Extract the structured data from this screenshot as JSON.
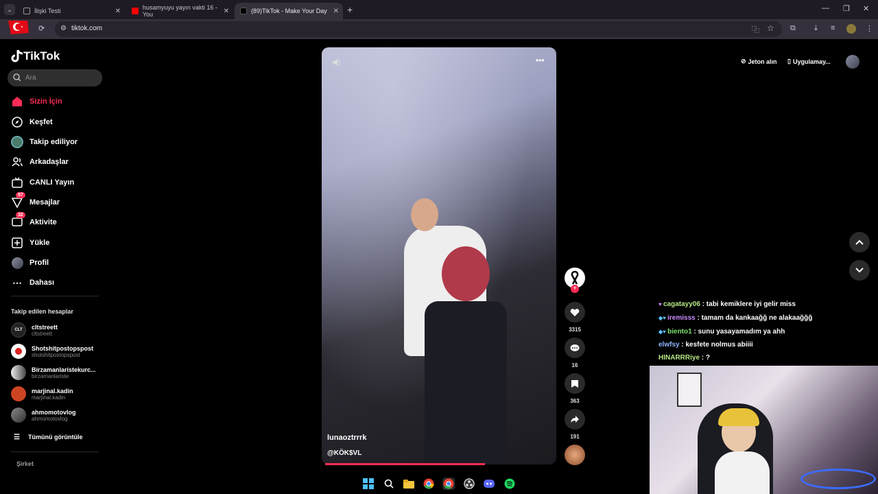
{
  "browser": {
    "tabs": [
      {
        "title": "İlişki Testi",
        "active": false
      },
      {
        "title": "husamyuyu yayın vakti 16 - You",
        "active": false
      },
      {
        "title": "(89)TikTok - Make Your Day",
        "active": true
      }
    ],
    "url": "tiktok.com"
  },
  "sidebar": {
    "logo": "TikTok",
    "search_placeholder": "Ara",
    "nav": [
      {
        "label": "Sizin İçin",
        "icon": "home-icon",
        "active": true
      },
      {
        "label": "Keşfet",
        "icon": "compass-icon"
      },
      {
        "label": "Takip ediliyor",
        "icon": "following-avatar-icon"
      },
      {
        "label": "Arkadaşlar",
        "icon": "friends-icon"
      },
      {
        "label": "CANLI Yayın",
        "icon": "live-icon"
      },
      {
        "label": "Mesajlar",
        "icon": "messages-icon",
        "badge": "57"
      },
      {
        "label": "Aktivite",
        "icon": "activity-icon",
        "badge": "32"
      },
      {
        "label": "Yükle",
        "icon": "upload-icon"
      },
      {
        "label": "Profil",
        "icon": "profile-avatar-icon"
      },
      {
        "label": "Dahası",
        "icon": "more-icon"
      }
    ],
    "following_header": "Takip edilen hesaplar",
    "following": [
      {
        "name": "cltstreett",
        "handle": "cltstreett",
        "avatar": "CLT"
      },
      {
        "name": "Shotshitpostopspost",
        "handle": "shotshitpostopspost",
        "avatar": ""
      },
      {
        "name": "Birzamanlaristekurc...",
        "handle": "birzamanlariste",
        "avatar": ""
      },
      {
        "name": "marjinal.kadin",
        "handle": "marjinal.kadin",
        "avatar": ""
      },
      {
        "name": "ahmomotovlog",
        "handle": "ahmomotovlog",
        "avatar": ""
      }
    ],
    "see_all": "Tümünü görüntüle",
    "company": "Şirket"
  },
  "video": {
    "author": "lunaoztrrrk",
    "sound": "@KÖK$VL",
    "progress": 0.68
  },
  "actions": {
    "likes": "3315",
    "comments": "16",
    "saves": "363",
    "shares": "191"
  },
  "topbar": {
    "coins": "Jeton alın",
    "app": "Uygulamay..."
  },
  "chat": [
    {
      "user": "cagatayy06",
      "text": " : tabi kemiklere iyi gelir miss",
      "color": "#b8e986"
    },
    {
      "user": "iremisss",
      "text": " : tamam da kankaağğ ne alakaağğğ",
      "color": "#c88cff"
    },
    {
      "user": "biento1",
      "text": " : sunu yasayamadım ya ahh",
      "color": "#7ee36f"
    },
    {
      "user": "elwfsy",
      "text": " : kesfete nolmus abiiii",
      "color": "#8fb8ff"
    },
    {
      "user": "HINARRRiye",
      "text": " : ?",
      "color": "#b8e986"
    }
  ]
}
